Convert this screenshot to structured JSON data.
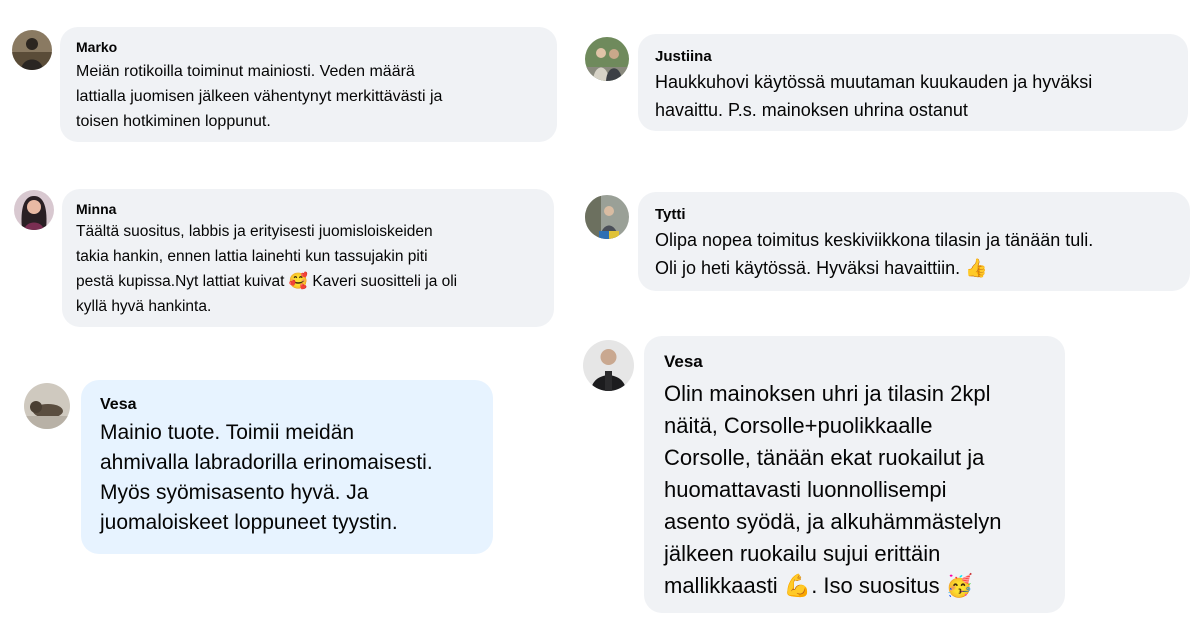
{
  "comments": [
    {
      "id": "marko",
      "name": "Marko",
      "lines": [
        "Meiän rotikoilla toiminut mainiosti. Veden määrä",
        "lattialla juomisen jälkeen vähentynyt merkittävästi ja",
        "toisen hotkiminen loppunut."
      ],
      "avatar_icon": "profile-photo-person-icon"
    },
    {
      "id": "minna",
      "name": "Minna",
      "lines": [
        "Täältä suositus, labbis ja erityisesti juomisloiskeiden",
        "takia hankin, ennen lattia lainehti kun tassujakin piti",
        "pestä kupissa.Nyt lattiat kuivat 🥰 Kaveri suositteli ja oli",
        "kyllä hyvä hankinta."
      ],
      "avatar_icon": "profile-photo-person-icon"
    },
    {
      "id": "vesa1",
      "name": "Vesa",
      "lines": [
        "Mainio tuote. Toimii meidän",
        "ahmivalla labradorilla erinomaisesti.",
        "Myös syömisasento hyvä. Ja",
        "juomaloiskeet loppuneet tyystin."
      ],
      "avatar_icon": "profile-photo-dog-icon"
    },
    {
      "id": "justiina",
      "name": "Justiina",
      "lines": [
        "Haukkuhovi käytössä muutaman kuukauden ja hyväksi",
        "havaittu. P.s. mainoksen uhrina ostanut"
      ],
      "avatar_icon": "profile-photo-people-icon"
    },
    {
      "id": "tytti",
      "name": "Tytti",
      "lines": [
        "Olipa nopea toimitus keskiviikkona tilasin ja tänään tuli.",
        "Oli jo heti käytössä. Hyväksi havaittiin. 👍"
      ],
      "avatar_icon": "profile-photo-person-icon"
    },
    {
      "id": "vesa2",
      "name": "Vesa",
      "lines": [
        "Olin mainoksen uhri ja tilasin 2kpl",
        "näitä, Corsolle+puolikkaalle",
        "Corsolle, tänään ekat ruokailut ja",
        "huomattavasti luonnollisempi",
        "asento syödä, ja alkuhämmästelyn",
        "jälkeen ruokailu sujui erittäin",
        "mallikkaasti 💪. Iso suositus 🥳"
      ],
      "avatar_icon": "profile-photo-person-icon"
    }
  ],
  "colors": {
    "bubble_gray": "#f0f2f5",
    "bubble_blue": "#e7f3ff",
    "text": "#050505"
  }
}
